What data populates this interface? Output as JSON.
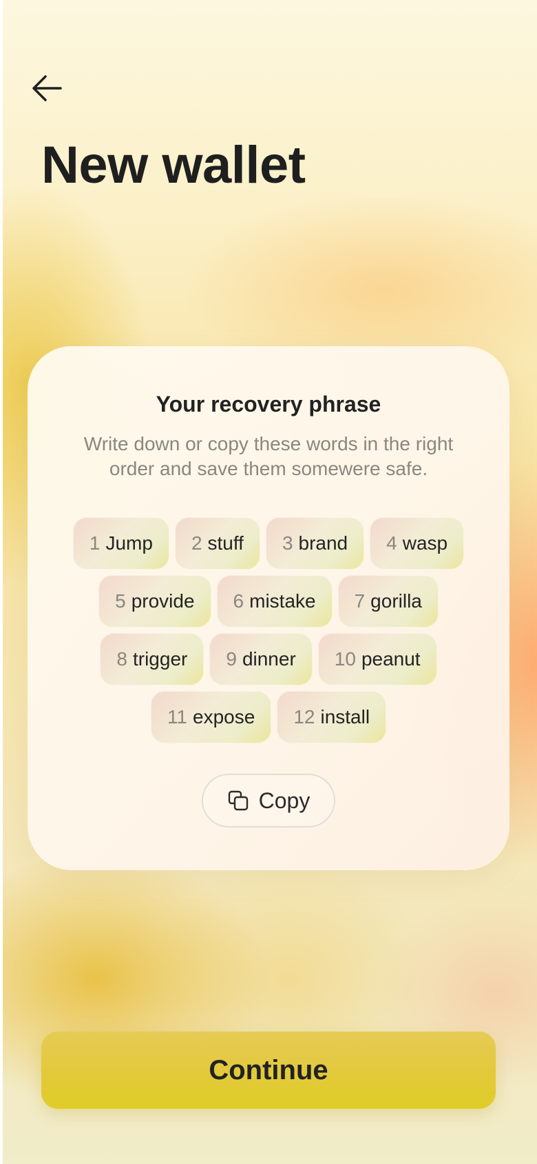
{
  "header": {
    "back_icon": "arrow-left-icon",
    "title": "New wallet"
  },
  "card": {
    "title": "Your recovery phrase",
    "description": "Write down or copy these words in the right order and save them somewere safe.",
    "words": [
      {
        "num": "1",
        "word": "Jump"
      },
      {
        "num": "2",
        "word": "stuff"
      },
      {
        "num": "3",
        "word": "brand"
      },
      {
        "num": "4",
        "word": "wasp"
      },
      {
        "num": "5",
        "word": "provide"
      },
      {
        "num": "6",
        "word": "mistake"
      },
      {
        "num": "7",
        "word": "gorilla"
      },
      {
        "num": "8",
        "word": "trigger"
      },
      {
        "num": "9",
        "word": "dinner"
      },
      {
        "num": "10",
        "word": "peanut"
      },
      {
        "num": "11",
        "word": "expose"
      },
      {
        "num": "12",
        "word": "install"
      }
    ],
    "copy_label": "Copy",
    "copy_icon": "copy-icon"
  },
  "footer": {
    "continue_label": "Continue"
  },
  "colors": {
    "accent": "#E2C93A",
    "text": "#1F1F1F",
    "muted": "#8A8680"
  }
}
